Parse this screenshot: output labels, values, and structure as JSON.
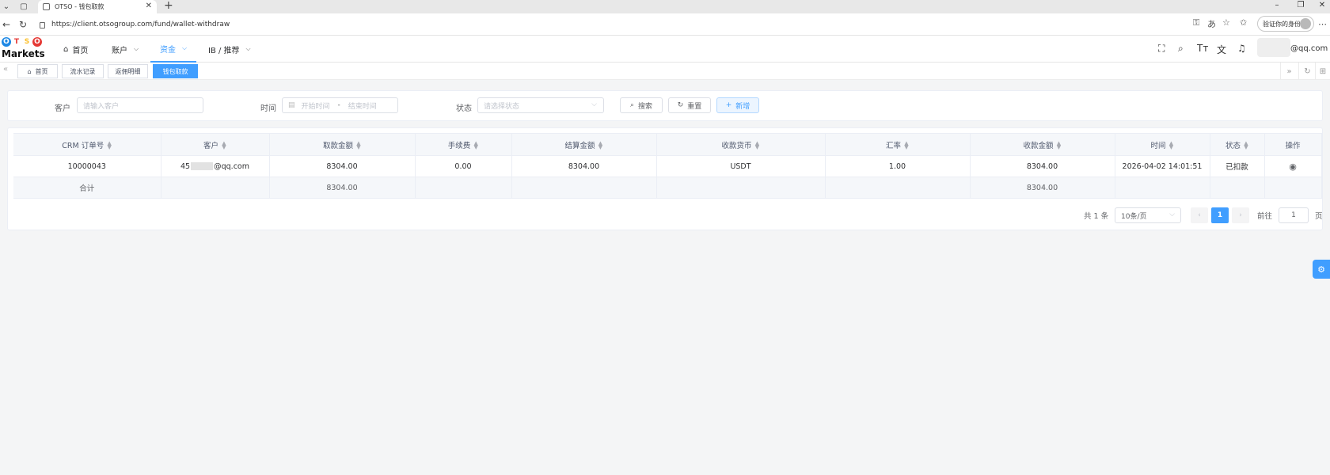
{
  "browser": {
    "tab_title": "OTSO - 钱包取款",
    "url": "https://client.otsogroup.com/fund/wallet-withdraw",
    "profile_label": "验证你的身份"
  },
  "header": {
    "logo_letters": [
      "O",
      "T",
      "S",
      "O"
    ],
    "logo_word": "Markets",
    "menu": [
      {
        "label": "首页"
      },
      {
        "label": "账户"
      },
      {
        "label": "资金"
      },
      {
        "label": "IB / 推荐"
      }
    ],
    "user_email_suffix": "@qq.com"
  },
  "tags": [
    {
      "label": "首页"
    },
    {
      "label": "流水记录"
    },
    {
      "label": "返佣明细"
    },
    {
      "label": "钱包取款"
    }
  ],
  "filter": {
    "customer_label": "客户",
    "customer_placeholder": "请输入客户",
    "time_label": "时间",
    "start_placeholder": "开始时间",
    "range_sep": "-",
    "end_placeholder": "结束时间",
    "status_label": "状态",
    "status_placeholder": "请选择状态",
    "search_btn": "搜索",
    "reset_btn": "重置",
    "add_btn": "新增"
  },
  "table": {
    "columns": [
      "CRM 订单号",
      "客户",
      "取款金额",
      "手续费",
      "结算金额",
      "收款货币",
      "汇率",
      "收款金额",
      "时间",
      "状态",
      "操作"
    ],
    "rows": [
      {
        "order_no": "10000043",
        "customer_prefix": "45",
        "customer_suffix": "@qq.com",
        "amount": "8304.00",
        "fee": "0.00",
        "settle": "8304.00",
        "currency": "USDT",
        "rate": "1.00",
        "received": "8304.00",
        "time": "2026-04-02 14:01:51",
        "status": "已扣款"
      }
    ],
    "summary": {
      "label": "合计",
      "amount": "8304.00",
      "received": "8304.00"
    }
  },
  "pagination": {
    "total_text": "共 1 条",
    "page_size": "10条/页",
    "current_page": "1",
    "goto_label": "前往",
    "goto_value": "1",
    "page_unit": "页"
  },
  "colors": {
    "accent": "#409eff",
    "logo_o1": "#1e88e5",
    "logo_t": "#e53935",
    "logo_s": "#fbc02d",
    "logo_o2": "#e53935"
  }
}
